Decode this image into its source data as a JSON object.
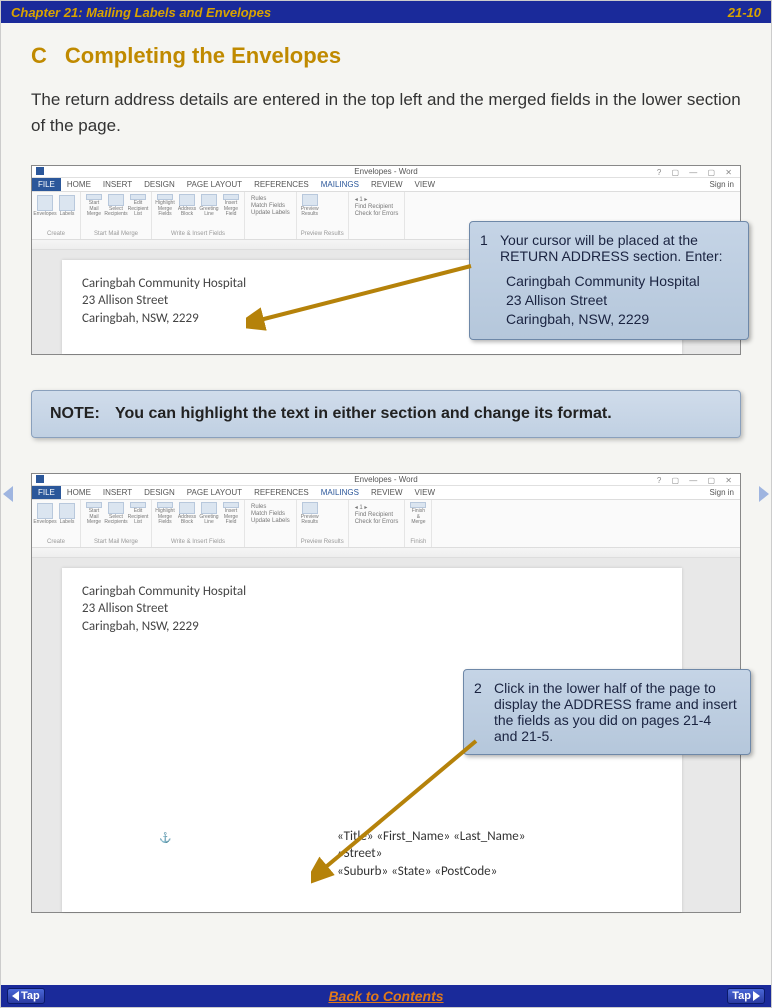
{
  "header": {
    "chapter_title": "Chapter 21: Mailing Labels and Envelopes",
    "page_number": "21-10"
  },
  "section": {
    "letter": "C",
    "title": "Completing the Envelopes"
  },
  "intro_text": "The return address details are entered in the top left and the merged fields in the lower section of the page.",
  "word_app": {
    "window_title": "Envelopes - Word",
    "sys_help": "?",
    "sign_in": "Sign in",
    "tabs": {
      "file": "FILE",
      "home": "HOME",
      "insert": "INSERT",
      "design": "DESIGN",
      "page_layout": "PAGE LAYOUT",
      "references": "REFERENCES",
      "mailings": "MAILINGS",
      "review": "REVIEW",
      "view": "VIEW"
    },
    "ribbon": {
      "create": {
        "envelopes": "Envelopes",
        "labels": "Labels",
        "group": "Create"
      },
      "start_merge": {
        "start": "Start Mail Merge",
        "select": "Select Recipients",
        "edit": "Edit Recipient List",
        "group": "Start Mail Merge"
      },
      "write_insert": {
        "highlight": "Highlight Merge Fields",
        "address": "Address Block",
        "greeting": "Greeting Line",
        "insert": "Insert Merge Field",
        "rules": "Rules",
        "match": "Match Fields",
        "update": "Update Labels",
        "group": "Write & Insert Fields"
      },
      "preview": {
        "preview": "Preview Results",
        "find": "Find Recipient",
        "check": "Check for Errors",
        "record": "1",
        "group": "Preview Results"
      },
      "finish": {
        "finish": "Finish & Merge",
        "group": "Finish"
      }
    },
    "return_address": {
      "line1": "Caringbah Community Hospital",
      "line2": "23 Allison Street",
      "line3": "Caringbah, NSW, 2229"
    },
    "merge_fields": {
      "line1": "«Title» «First_Name» «Last_Name»",
      "line2": "«Street»",
      "line3": "«Suburb» «State» «PostCode»"
    }
  },
  "callouts": {
    "c1": {
      "num": "1",
      "text": "Your cursor will be placed at the RETURN ADDRESS section.  Enter:",
      "sub1": "Caringbah Community Hospital",
      "sub2": "23 Allison Street",
      "sub3": "Caringbah, NSW, 2229"
    },
    "c2": {
      "num": "2",
      "text": "Click in the lower half of the page to display the ADDRESS frame and insert the fields as you did on pages 21-4 and 21-5."
    }
  },
  "note": {
    "label": "NOTE:",
    "text": "You can highlight the text in either section and change its format."
  },
  "footer": {
    "tap": "Tap",
    "back": "Back to Contents"
  }
}
